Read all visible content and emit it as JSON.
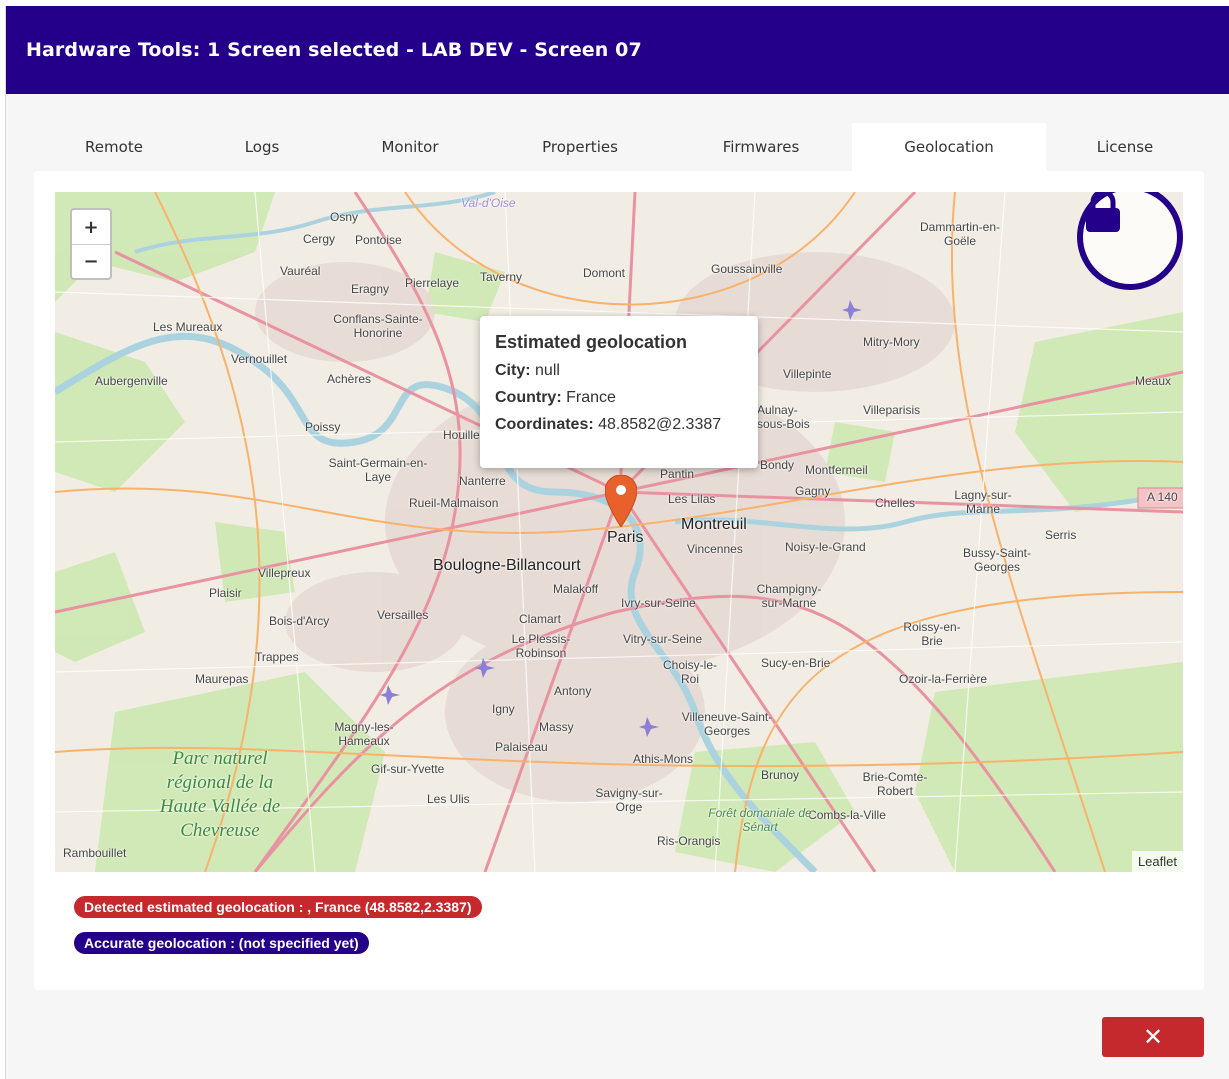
{
  "header": {
    "title": "Hardware Tools: 1 Screen selected - LAB DEV - Screen 07"
  },
  "tabs": [
    {
      "label": "Remote"
    },
    {
      "label": "Logs"
    },
    {
      "label": "Monitor"
    },
    {
      "label": "Properties"
    },
    {
      "label": "Firmwares"
    },
    {
      "label": "Geolocation",
      "active": true
    },
    {
      "label": "License"
    }
  ],
  "map": {
    "zoom_in": "+",
    "zoom_out": "−",
    "attribution": "Leaflet",
    "lock_icon": "lock-icon",
    "popup": {
      "title": "Estimated geolocation",
      "city_label": "City:",
      "city_value": "null",
      "country_label": "Country:",
      "country_value": "France",
      "coords_label": "Coordinates:",
      "coords_value": "48.8582@2.3387"
    },
    "labels": {
      "paris": "Paris",
      "boulogne": "Boulogne-Billancourt",
      "montreuil": "Montreuil",
      "osny": "Osny",
      "cergy": "Cergy",
      "pontoise": "Pontoise",
      "vaureal": "Vauréal",
      "eragny": "Eragny",
      "pierrelaye": "Pierrelaye",
      "taverny": "Taverny",
      "domont": "Domont",
      "goussainville": "Goussainville",
      "dammartin": "Dammartin-en-Goële",
      "conflans": "Conflans-Sainte-Honorine",
      "lesmureaux": "Les Mureaux",
      "vernouillet": "Vernouillet",
      "aubergenville": "Aubergenville",
      "acheres": "Achères",
      "poissy": "Poissy",
      "houilles": "Houilles",
      "mitrymory": "Mitry-Mory",
      "villepinte": "Villepinte",
      "meaux": "Meaux",
      "villeparisis": "Villeparisis",
      "saintgermain": "Saint-Germain-en-Laye",
      "nanterre": "Nanterre",
      "rueil": "Rueil-Malmaison",
      "pantin": "Pantin",
      "leslilas": "Les Lilas",
      "montfermeil": "Montfermeil",
      "gagny": "Gagny",
      "chelles": "Chelles",
      "lagny": "Lagny-sur-Marne",
      "serris": "Serris",
      "vincennes": "Vincennes",
      "noisy": "Noisy-le-Grand",
      "bussy": "Bussy-Saint-Georges",
      "villepreux": "Villepreux",
      "plaisir": "Plaisir",
      "versailles": "Versailles",
      "boisdarcy": "Bois-d'Arcy",
      "trappes": "Trappes",
      "maurepas": "Maurepas",
      "malakoff": "Malakoff",
      "ivry": "Ivry-sur-Seine",
      "clamart": "Clamart",
      "leplessis": "Le Plessis-Robinson",
      "vitry": "Vitry-sur-Seine",
      "champigny": "Champigny-sur-Marne",
      "roissy": "Roissy-en-Brie",
      "choisy": "Choisy-le-Roi",
      "sucy": "Sucy-en-Brie",
      "ozoir": "Ozoir-la-Ferrière",
      "antony": "Antony",
      "igny": "Igny",
      "massy": "Massy",
      "palaiseau": "Palaiseau",
      "magny": "Magny-les-Hameaux",
      "villeneuve": "Villeneuve-Saint-Georges",
      "athis": "Athis-Mons",
      "gif": "Gif-sur-Yvette",
      "brunoy": "Brunoy",
      "brie": "Brie-Comte-Robert",
      "lesulis": "Les Ulis",
      "savigny": "Savigny-sur-Orge",
      "combs": "Combs-la-Ville",
      "senart": "Forêt domaniale de Sénart",
      "risorangis": "Ris-Orangis",
      "rambouillet": "Rambouillet",
      "park": "Parc naturel régional de la Haute Vallée de Chevreuse",
      "a140": "A 140",
      "valdoise": "Val-d'Oise",
      "aulnay": "Aulnay-sous-Bois",
      "bondy": "Bondy"
    }
  },
  "badges": {
    "detected": "Detected estimated geolocation :  , France (48.8582,2.3387)",
    "accurate": "Accurate geolocation :  (not specified yet)"
  },
  "footer": {
    "close_label": "✕"
  },
  "colors": {
    "brand": "#24008a",
    "danger": "#c5282d",
    "marker": "#e8612c"
  }
}
